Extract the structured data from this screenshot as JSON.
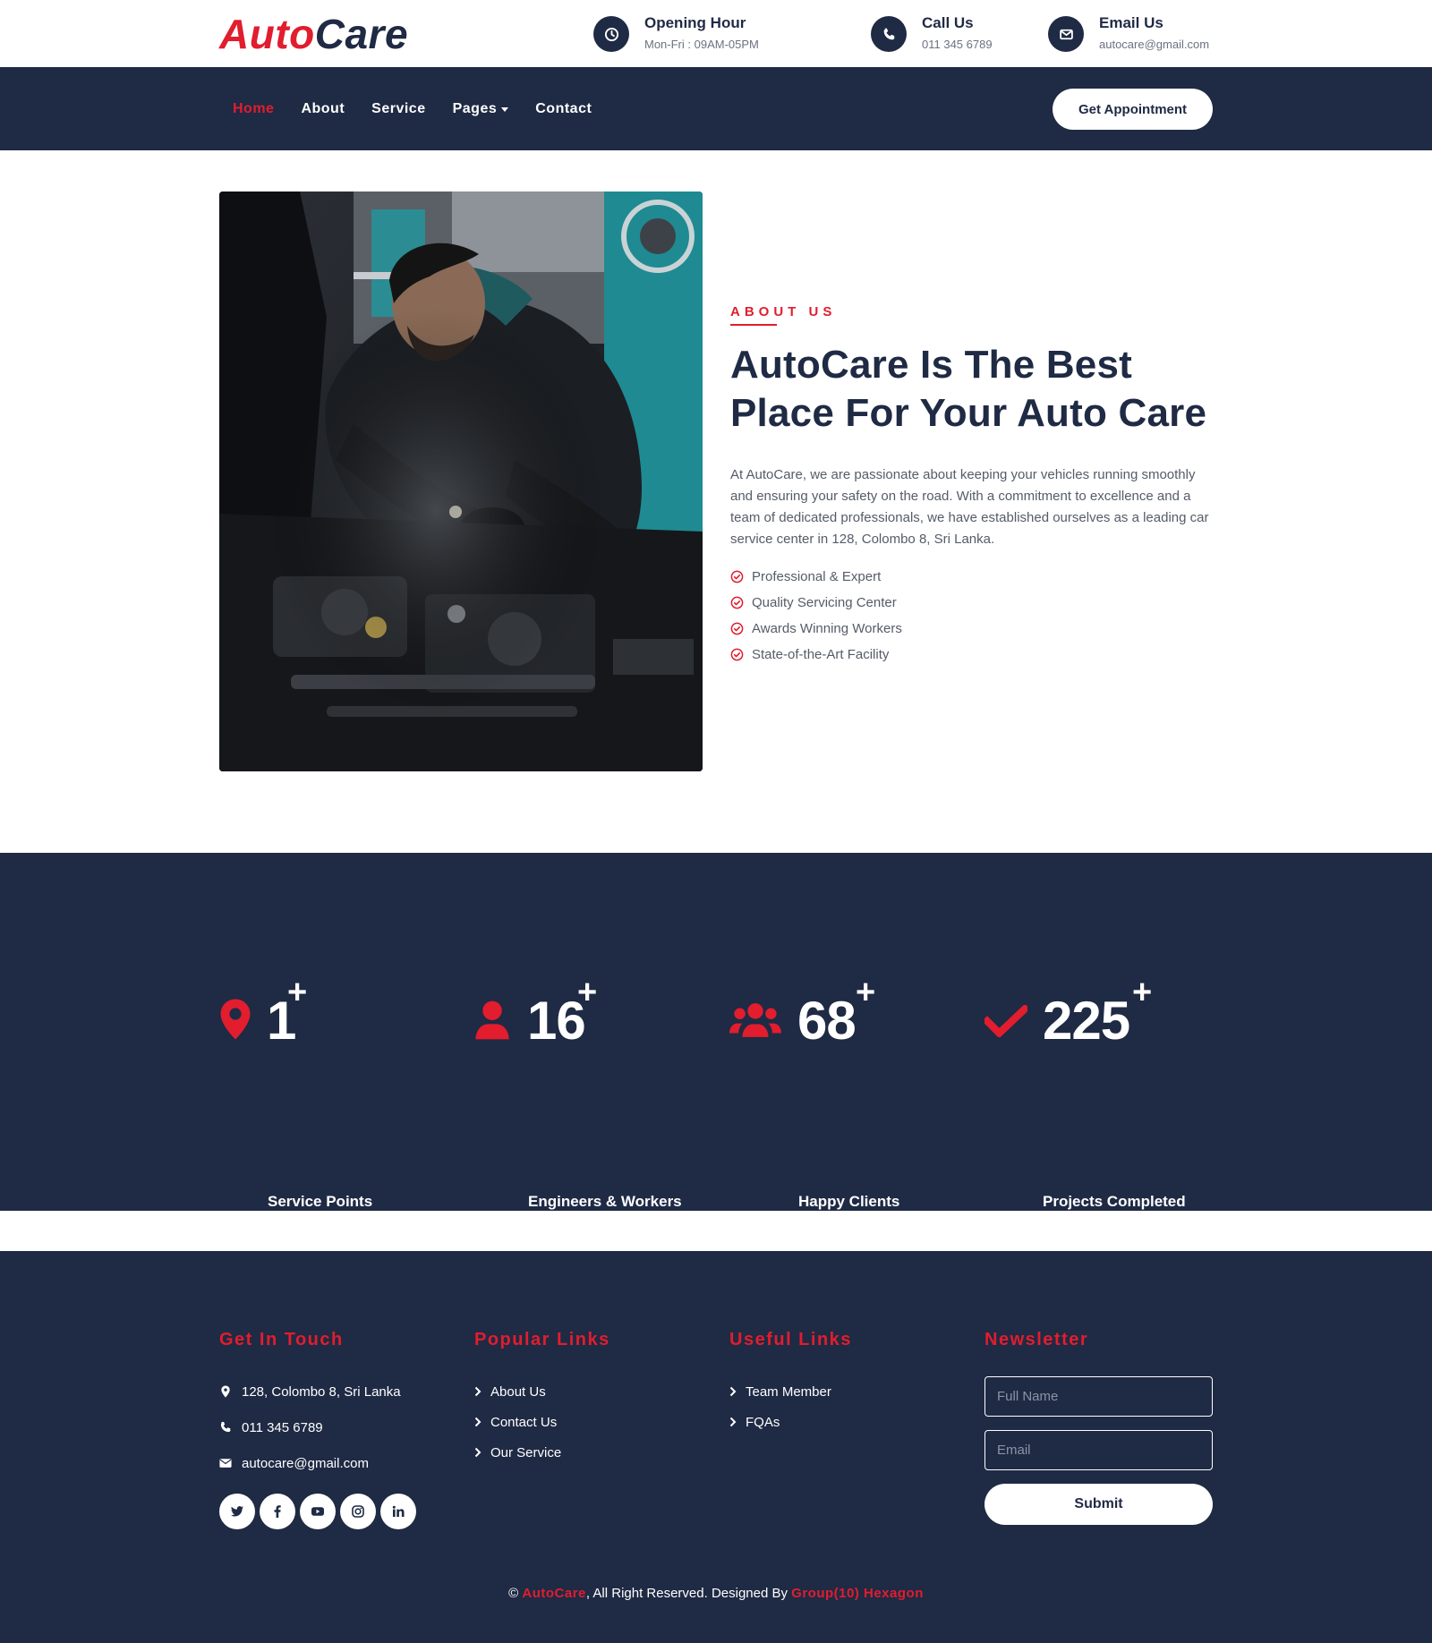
{
  "brand": {
    "part1": "Auto",
    "part2": "Care"
  },
  "topbar": {
    "opening": {
      "title": "Opening Hour",
      "value": "Mon-Fri : 09AM-05PM",
      "icon": "clock-icon"
    },
    "call": {
      "title": "Call Us",
      "value": "011 345 6789",
      "icon": "phone-icon"
    },
    "email": {
      "title": "Email Us",
      "value": "autocare@gmail.com",
      "icon": "envelope-icon"
    }
  },
  "nav": {
    "items": [
      {
        "label": "Home",
        "active": true
      },
      {
        "label": "About"
      },
      {
        "label": "Service"
      },
      {
        "label": "Pages",
        "dropdown": true
      },
      {
        "label": "Contact"
      }
    ],
    "cta": "Get Appointment"
  },
  "about": {
    "eyebrow": "ABOUT US",
    "title": "AutoCare Is The Best Place For Your Auto Care",
    "description": "At AutoCare, we are passionate about keeping your vehicles running smoothly and ensuring your safety on the road. With a commitment to excellence and a team of dedicated professionals, we have established ourselves as a leading car service center in 128, Colombo 8, Sri Lanka.",
    "checklist": [
      "Professional & Expert",
      "Quality Servicing Center",
      "Awards Winning Workers",
      "State-of-the-Art Facility"
    ]
  },
  "stats": [
    {
      "value": "1",
      "suffix": "+",
      "label": "Service Points",
      "icon": "map-marker-icon"
    },
    {
      "value": "16",
      "suffix": "+",
      "label": "Engineers & Workers",
      "icon": "user-icon"
    },
    {
      "value": "68",
      "suffix": "+",
      "label": "Happy Clients",
      "icon": "users-icon"
    },
    {
      "value": "225",
      "suffix": "+",
      "label": "Projects Completed",
      "icon": "check-icon"
    }
  ],
  "footer": {
    "touch": {
      "heading": "Get In Touch",
      "address": "128, Colombo 8, Sri Lanka",
      "phone": "011 345 6789",
      "email": "autocare@gmail.com"
    },
    "socials": [
      "twitter-icon",
      "facebook-icon",
      "youtube-icon",
      "instagram-icon",
      "linkedin-icon"
    ],
    "popular": {
      "heading": "Popular Links",
      "links": [
        "About Us",
        "Contact Us",
        "Our Service"
      ]
    },
    "useful": {
      "heading": "Useful Links",
      "links": [
        "Team Member",
        "FQAs"
      ]
    },
    "newsletter": {
      "heading": "Newsletter",
      "name_placeholder": "Full Name",
      "email_placeholder": "Email",
      "submit": "Submit"
    },
    "copyright": {
      "prefix": "© ",
      "brand": "AutoCare",
      "middle": ", All Right Reserved. Designed By ",
      "designer": "Group(10) Hexagon"
    }
  },
  "colors": {
    "navy": "#1f2a44",
    "accent": "#e11d2e",
    "white": "#ffffff"
  }
}
